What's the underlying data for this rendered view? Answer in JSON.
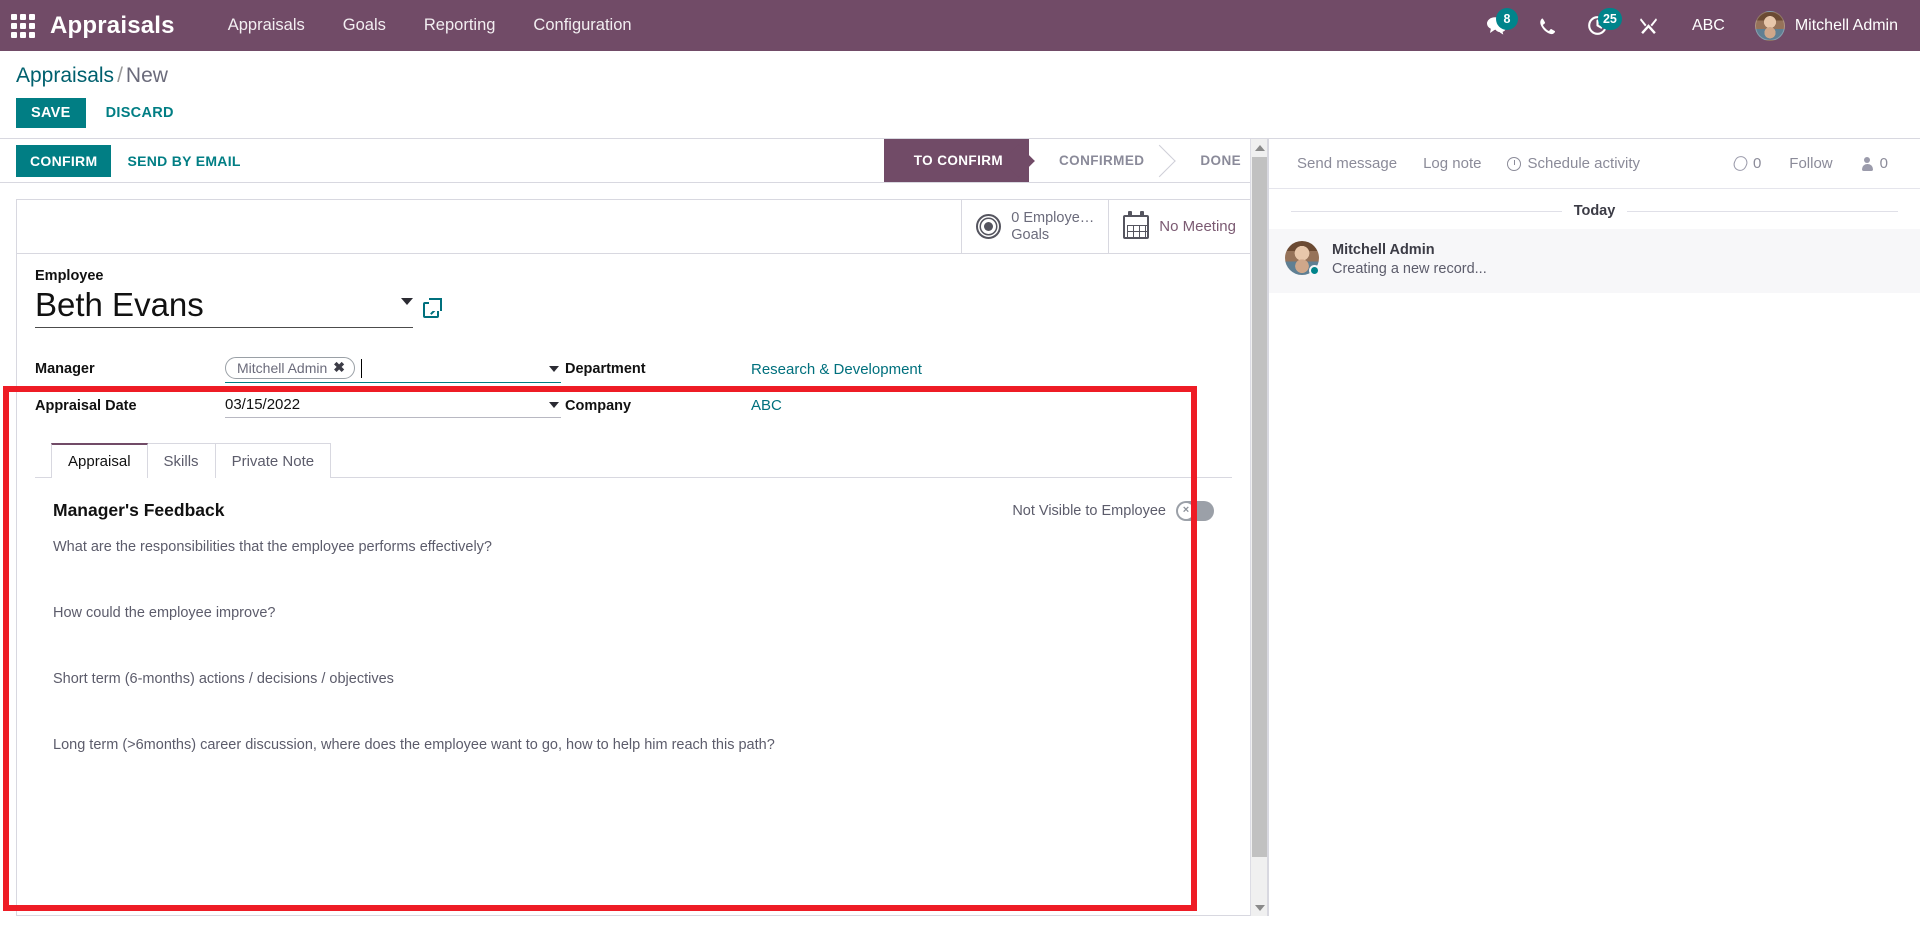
{
  "navbar": {
    "apps_icon": "apps-grid-icon",
    "brand": "Appraisals",
    "menu": [
      {
        "label": "Appraisals"
      },
      {
        "label": "Goals"
      },
      {
        "label": "Reporting"
      },
      {
        "label": "Configuration"
      }
    ],
    "messages_icon": "chat-bubble-icon",
    "messages_count": "8",
    "phone_icon": "phone-icon",
    "activities_icon": "clock-icon",
    "activities_count": "25",
    "debug_icon": "tools-icon",
    "company": "ABC",
    "user_avatar": "user-avatar",
    "user_name": "Mitchell Admin"
  },
  "control_panel": {
    "breadcrumb_root": "Appraisals",
    "breadcrumb_sep": "/",
    "breadcrumb_current": "New",
    "save_label": "SAVE",
    "discard_label": "DISCARD"
  },
  "statusbar": {
    "confirm_label": "CONFIRM",
    "send_by_email_label": "SEND BY EMAIL",
    "stages": [
      {
        "label": "TO CONFIRM",
        "active": true
      },
      {
        "label": "CONFIRMED",
        "active": false
      },
      {
        "label": "DONE",
        "active": false
      }
    ]
  },
  "smart_buttons": [
    {
      "icon": "target-icon",
      "line1": "0 Employe…",
      "line2": "Goals"
    },
    {
      "icon": "calendar-icon",
      "line1": "No Meeting",
      "line2": ""
    }
  ],
  "form": {
    "employee_label": "Employee",
    "employee_value": "Beth Evans",
    "employee_dropdown_icon": "chevron-down-icon",
    "employee_external_link_icon": "external-link-icon",
    "manager_label": "Manager",
    "manager_tag": "Mitchell Admin",
    "manager_tag_remove_icon": "close-icon",
    "manager_dropdown_icon": "chevron-down-icon",
    "appraisal_date_label": "Appraisal Date",
    "appraisal_date_value": "03/15/2022",
    "appraisal_date_dropdown_icon": "chevron-down-icon",
    "department_label": "Department",
    "department_value": "Research & Development",
    "company_label": "Company",
    "company_value": "ABC"
  },
  "notebook": {
    "tabs": [
      {
        "label": "Appraisal",
        "active": true
      },
      {
        "label": "Skills",
        "active": false
      },
      {
        "label": "Private Note",
        "active": false
      }
    ],
    "feedback_title": "Manager's Feedback",
    "visibility_label": "Not Visible to Employee",
    "visibility_toggle_state": "off",
    "visibility_toggle_glyph": "×",
    "questions": [
      "What are the responsibilities that the employee performs effectively?",
      "How could the employee improve?",
      "Short term (6-months) actions / decisions / objectives",
      "Long term (>6months) career discussion, where does the employee want to go, how to help him reach this path?"
    ]
  },
  "chatter": {
    "send_message_label": "Send message",
    "log_note_label": "Log note",
    "schedule_activity_icon": "clock-icon",
    "schedule_activity_label": "Schedule activity",
    "attachment_icon": "paperclip-icon",
    "attachment_count": "0",
    "follow_label": "Follow",
    "followers_icon": "person-icon",
    "followers_count": "0",
    "day_separator": "Today",
    "messages": [
      {
        "author": "Mitchell Admin",
        "body": "Creating a new record...",
        "avatar": "user-avatar"
      }
    ]
  },
  "annotation": {
    "highlight_color": "#ee1c25",
    "target": "appraisal-notebook"
  },
  "scrollbars": {
    "form_up_icon": "triangle-up-icon",
    "form_down_icon": "triangle-down-icon"
  },
  "theme": {
    "navbar_bg": "#714b67",
    "primary": "#017e84",
    "badge_bg": "#00848b",
    "link": "#00707d"
  }
}
